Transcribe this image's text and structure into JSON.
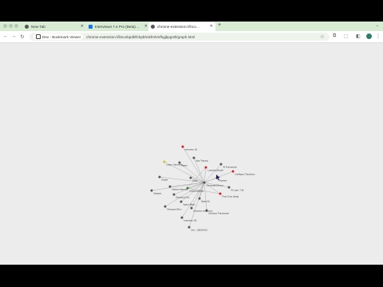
{
  "browser": {
    "tabs": [
      {
        "title": "New Tab",
        "favicon": "chrome-icon",
        "active": false
      },
      {
        "title": "Interview4 7.4 Pro (Beta) | ...",
        "favicon": "extension-icon",
        "active": false
      },
      {
        "title": "chrome-extension://ihcomy...",
        "favicon": "chrome-icon",
        "active": true
      }
    ],
    "new_tab_label": "+",
    "omnibox": {
      "site_chip": "Dex - Bookmark Viewer",
      "url": "chrome-extension://limcebpdkflchpbhnkfmhmfhgjbpgmll/graph.html"
    }
  },
  "graph": {
    "nodes": [
      {
        "id": "n1",
        "label": "interview: 81",
        "color": "#d11a2a"
      },
      {
        "id": "n2",
        "label": "App Tracing",
        "color": "#555555"
      },
      {
        "id": "n3",
        "label": "Layer: Interview...",
        "color": "#c8c81e"
      },
      {
        "id": "n4",
        "label": "Model",
        "color": "#555555"
      },
      {
        "id": "n5",
        "label": "Learning Model",
        "color": "#d11a2a"
      },
      {
        "id": "n6",
        "label": "AI Framework",
        "color": "#555555"
      },
      {
        "id": "n7",
        "label": "Intelligent Transform",
        "color": "#d11a2a"
      },
      {
        "id": "n8",
        "label": "Agent",
        "color": "#555555"
      },
      {
        "id": "n9",
        "label": "Dataset",
        "color": "#555555"
      },
      {
        "id": "n10",
        "label": "Variant Inferred",
        "color": "#555555"
      },
      {
        "id": "n11",
        "label": "Flow",
        "color": "#555555"
      },
      {
        "id": "n12",
        "label": "Interpretability",
        "color": "#2e7d32"
      },
      {
        "id": "n13",
        "label": "Generated Event",
        "color": "#555555"
      },
      {
        "id": "n14",
        "label": "Fix rate: 7.8x",
        "color": "#555555"
      },
      {
        "id": "n15",
        "label": "Pipeline",
        "color": "#555555"
      },
      {
        "id": "n16",
        "label": "Agent (Bidir...",
        "color": "#555555"
      },
      {
        "id": "n17",
        "label": "Fine-Tune (beta)",
        "color": "#d11a2a"
      },
      {
        "id": "n18",
        "label": "Research Run",
        "color": "#555555"
      },
      {
        "id": "n19",
        "label": "Research For",
        "color": "#555555"
      },
      {
        "id": "n20",
        "label": "Decision Framework",
        "color": "#555555"
      },
      {
        "id": "n21",
        "label": "Decision-sequence",
        "color": "#555555"
      },
      {
        "id": "n22",
        "label": "Interview: 83",
        "color": "#555555"
      },
      {
        "id": "n23",
        "label": "Dex - (DEX/IAX)",
        "color": "#555555"
      },
      {
        "id": "n24",
        "label": "Base Kit",
        "color": "#555555"
      }
    ],
    "edges": [
      [
        "n1",
        "n13"
      ],
      [
        "n2",
        "n13"
      ],
      [
        "n3",
        "n13"
      ],
      [
        "n4",
        "n13"
      ],
      [
        "n5",
        "n13"
      ],
      [
        "n6",
        "n13"
      ],
      [
        "n7",
        "n13"
      ],
      [
        "n8",
        "n13"
      ],
      [
        "n9",
        "n13"
      ],
      [
        "n10",
        "n13"
      ],
      [
        "n11",
        "n13"
      ],
      [
        "n12",
        "n13"
      ],
      [
        "n14",
        "n13"
      ],
      [
        "n15",
        "n13"
      ],
      [
        "n16",
        "n13"
      ],
      [
        "n17",
        "n13"
      ],
      [
        "n18",
        "n13"
      ],
      [
        "n19",
        "n13"
      ],
      [
        "n20",
        "n13"
      ],
      [
        "n21",
        "n13"
      ],
      [
        "n22",
        "n13"
      ],
      [
        "n24",
        "n13"
      ],
      [
        "n12",
        "n5"
      ],
      [
        "n12",
        "n17"
      ],
      [
        "n13",
        "n23"
      ]
    ]
  }
}
